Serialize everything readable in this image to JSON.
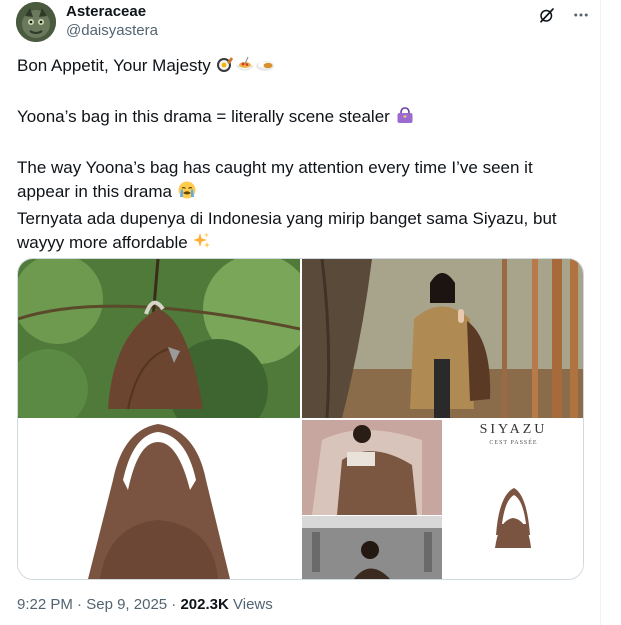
{
  "author": {
    "display_name": "Asteraceae",
    "handle": "@daisyastera"
  },
  "tweet": {
    "lines": [
      "Bon Appetit, Your Majesty",
      "Yoona’s bag in this drama = literally scene stealer",
      "The way Yoona’s bag has caught my attention every time I’ve seen it appear in this drama",
      "Ternyata ada dupenya di Indonesia yang mirip banget sama Siyazu, but wayyy more affordable"
    ],
    "emoji_icons": [
      "pan-egg-icon",
      "spaghetti-icon",
      "curry-rice-icon",
      "purse-icon",
      "crying-face-icon",
      "sparkles-icon"
    ]
  },
  "media": {
    "brand_text": "SIYAZU",
    "brand_sub": "CEST PASSÉE"
  },
  "meta": {
    "time": "9:22 PM",
    "separator": "·",
    "date": "Sep 9, 2025",
    "views_count": "202.3K",
    "views_label": "Views"
  },
  "colors": {
    "text": "#0f1419",
    "secondary": "#536471",
    "border": "#cfd9de"
  }
}
